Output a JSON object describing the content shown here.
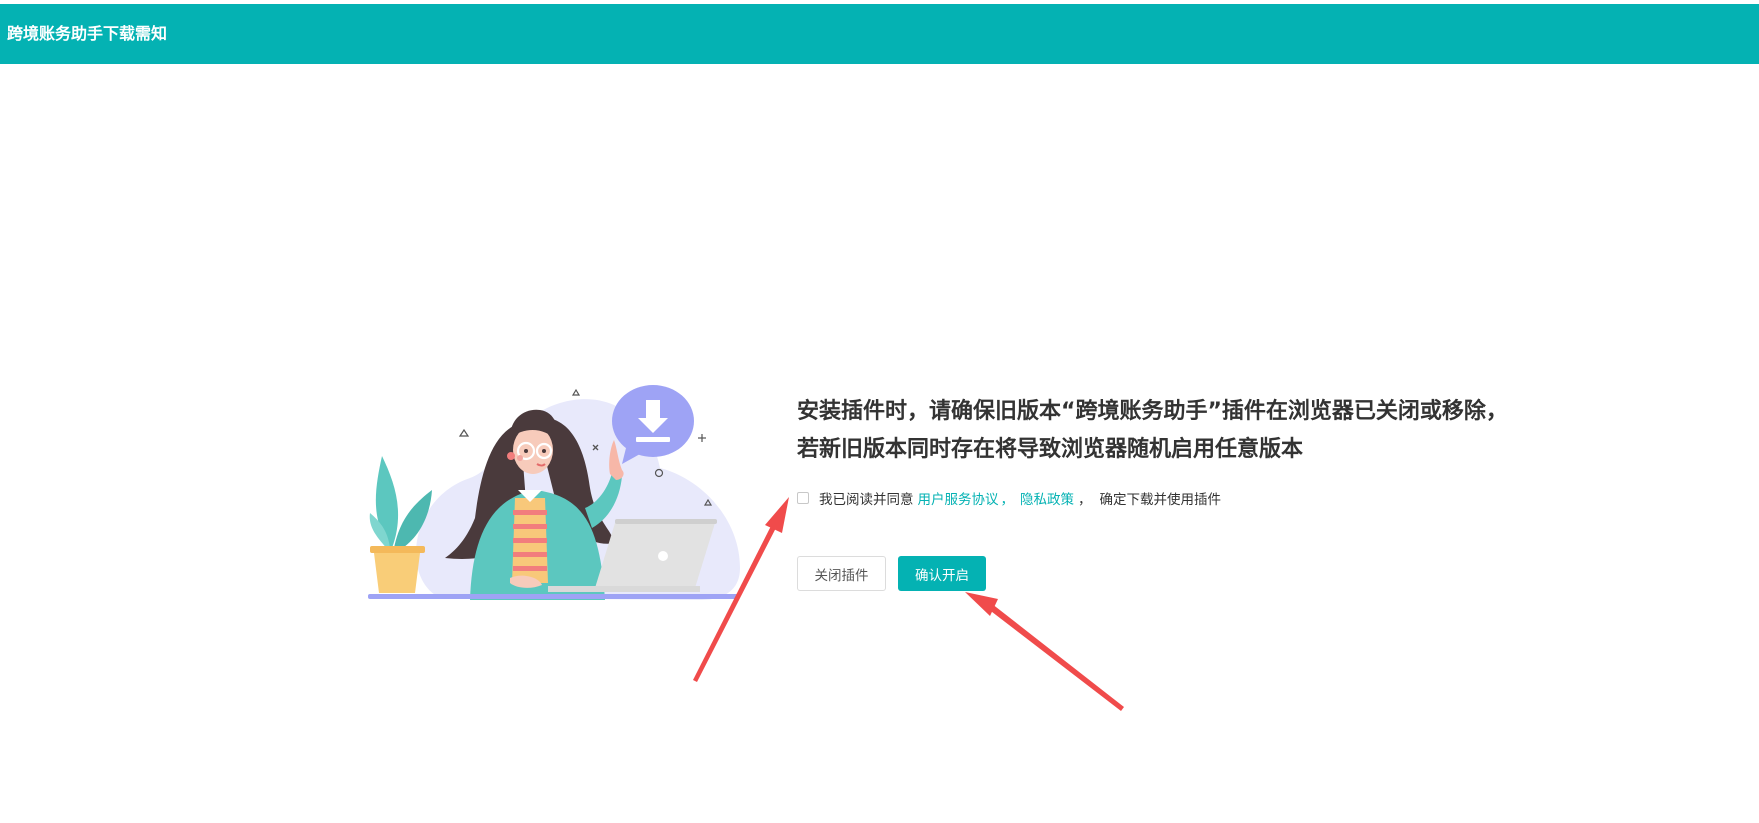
{
  "header": {
    "title": "跨境账务助手下载需知",
    "background_color": "#04b2b3"
  },
  "notice": {
    "line1": "安装插件时，请确保旧版本“跨境账务助手”插件在浏览器已关闭或移除，",
    "line2": "若新旧版本同时存在将导致浏览器随机启用任意版本"
  },
  "agreement": {
    "checked": false,
    "prefix": "我已阅读并同意",
    "service_link": "用户服务协议",
    "separator": "，",
    "privacy_link": "隐私政策",
    "comma": "，",
    "suffix": "确定下载并使用插件"
  },
  "buttons": {
    "close_label": "关闭插件",
    "confirm_label": "确认开启"
  },
  "colors": {
    "accent": "#04b2b3",
    "annotation_arrow": "#f04b4b"
  },
  "icons": {
    "illustration": "download-illustration",
    "download": "download-icon"
  }
}
